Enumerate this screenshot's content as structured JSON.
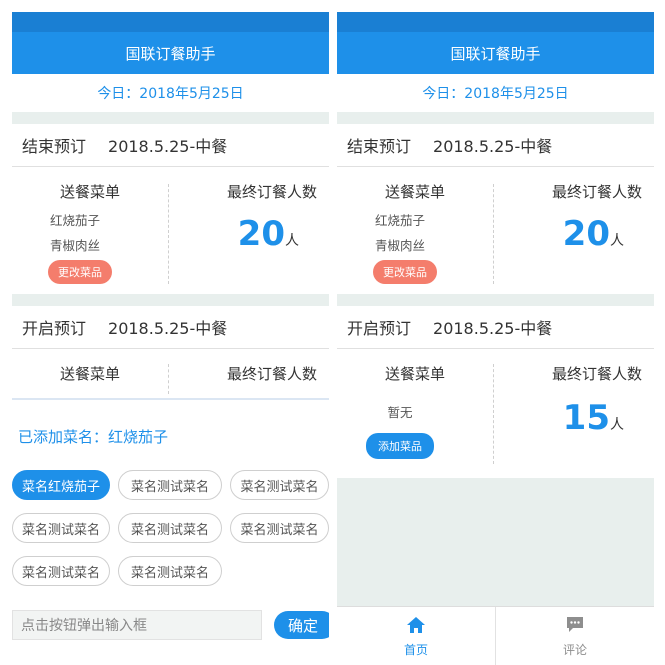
{
  "app_title": "国联订餐助手",
  "date_text": "今日：2018年5月25日",
  "left": {
    "closed_card": {
      "status": "结束预订",
      "meal": "2018.5.25-中餐",
      "menu_header": "送餐菜单",
      "dishes": [
        "红烧茄子",
        "青椒肉丝"
      ],
      "change_button": "更改菜品",
      "final_header": "最终订餐人数",
      "count": "20",
      "unit": "人"
    },
    "open_card": {
      "status": "开启预订",
      "meal": "2018.5.25-中餐",
      "menu_header": "送餐菜单",
      "final_header": "最终订餐人数"
    },
    "added_text": "已添加菜名：红烧茄子",
    "chips": [
      "菜名红烧茄子",
      "菜名测试菜名",
      "菜名测试菜名",
      "菜名测试菜名",
      "菜名测试菜名",
      "菜名测试菜名",
      "菜名测试菜名",
      "菜名测试菜名"
    ],
    "input_placeholder": "点击按钮弹出输入框",
    "confirm_button": "确定"
  },
  "right": {
    "closed_card": {
      "status": "结束预订",
      "meal": "2018.5.25-中餐",
      "menu_header": "送餐菜单",
      "dishes": [
        "红烧茄子",
        "青椒肉丝"
      ],
      "change_button": "更改菜品",
      "final_header": "最终订餐人数",
      "count": "20",
      "unit": "人"
    },
    "open_card": {
      "status": "开启预订",
      "meal": "2018.5.25-中餐",
      "menu_header": "送餐菜单",
      "empty_text": "暂无",
      "add_button": "添加菜品",
      "final_header": "最终订餐人数",
      "count": "15",
      "unit": "人"
    },
    "tabs": [
      {
        "label": "首页",
        "icon": "home-icon",
        "active": true
      },
      {
        "label": "评论",
        "icon": "comment-icon",
        "active": false
      }
    ]
  },
  "colors": {
    "primary": "#1e90e9",
    "accent": "#f47d6c",
    "background": "#e8efed"
  }
}
